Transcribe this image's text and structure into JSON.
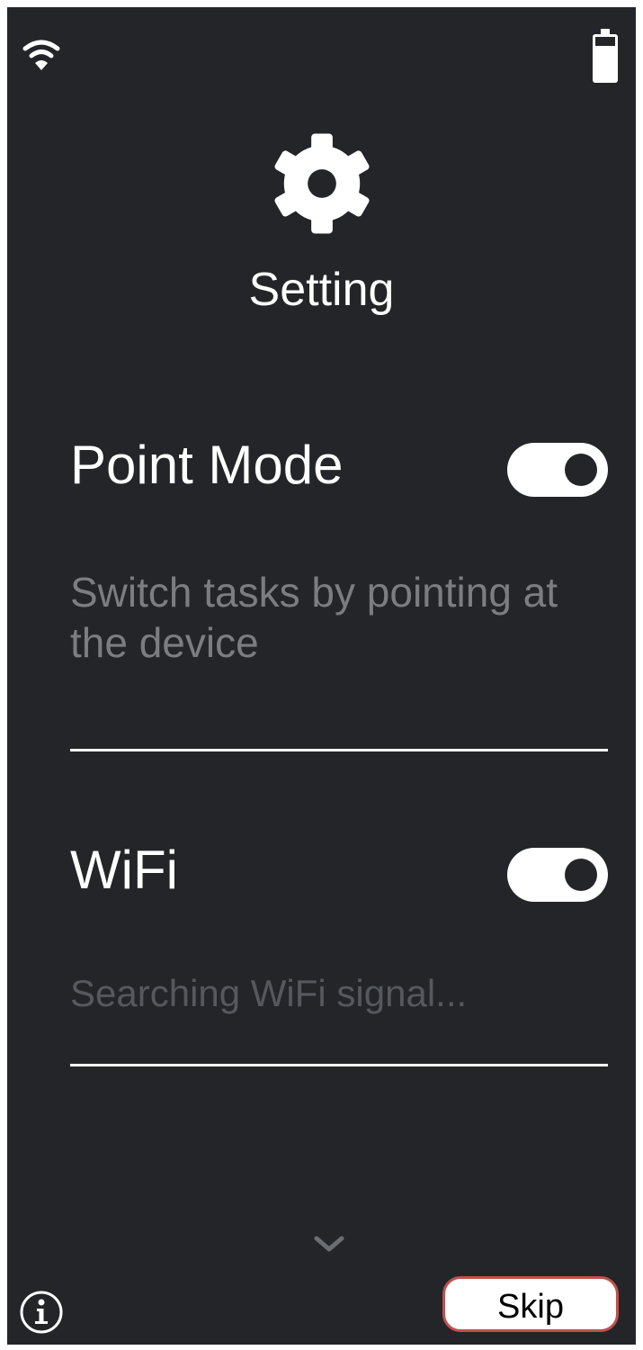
{
  "status_bar": {
    "wifi_icon": "wifi-icon",
    "battery_icon": "battery-icon"
  },
  "header": {
    "icon": "gear-icon",
    "title": "Setting"
  },
  "settings": [
    {
      "title": "Point Mode",
      "description": "Switch tasks by pointing at the device",
      "enabled": true
    },
    {
      "title": "WiFi",
      "description": "Searching WiFi signal...",
      "enabled": true
    }
  ],
  "footer": {
    "more_icon": "chevron-down-icon",
    "info_icon": "info-icon",
    "skip_label": "Skip"
  },
  "colors": {
    "background": "#232528",
    "foreground": "#ffffff",
    "muted_text": "#7b7d81",
    "skip_border": "#c0504d"
  }
}
